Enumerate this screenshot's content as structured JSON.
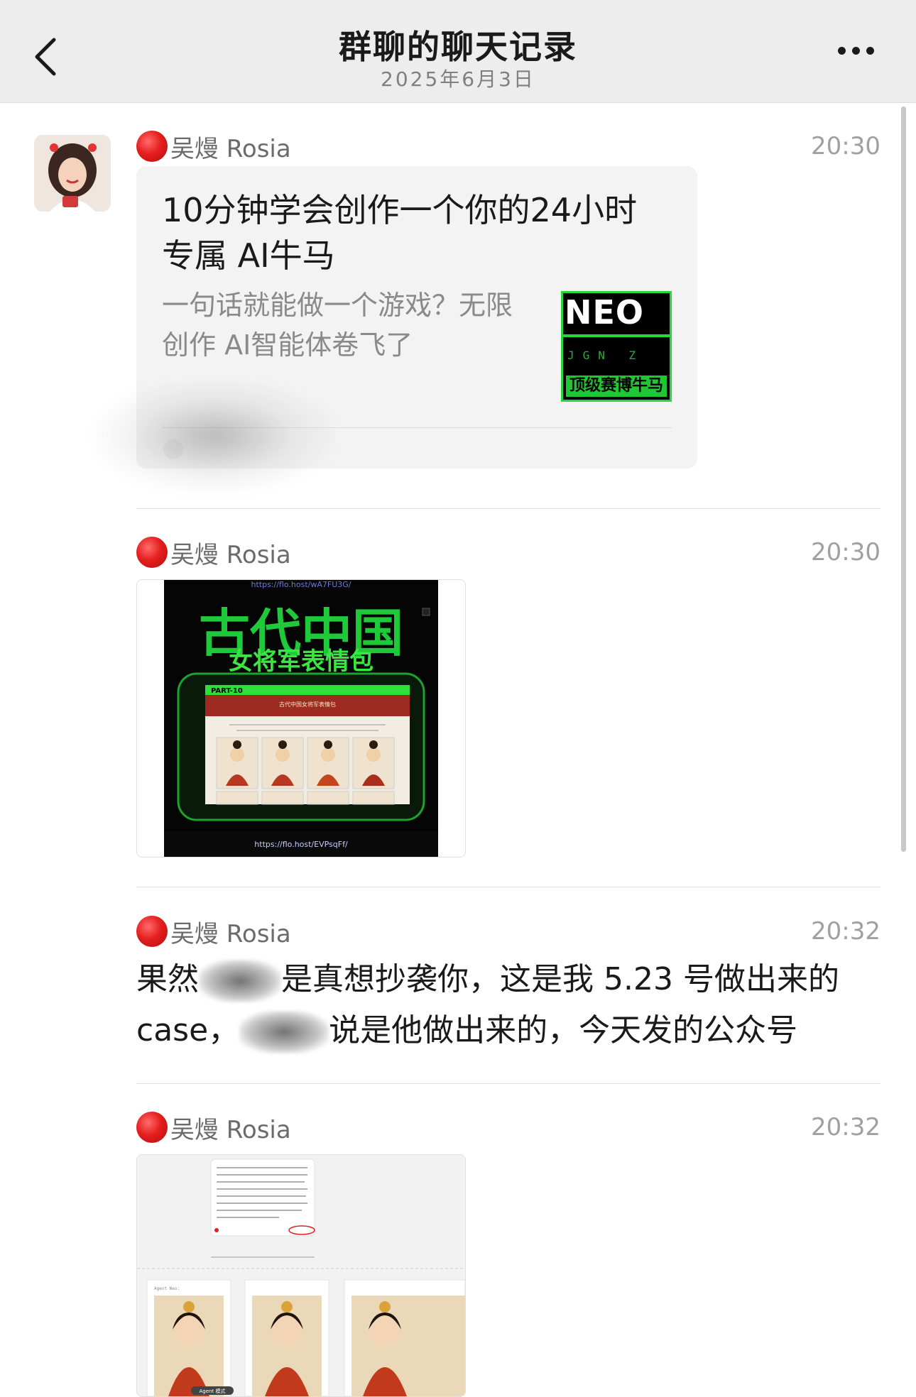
{
  "header": {
    "title": "群聊的聊天记录",
    "date": "2025年6月3日"
  },
  "messages": [
    {
      "sender": "吴熳 Rosia",
      "time": "20:30",
      "card": {
        "title": "10分钟学会创作一个你的24小时专属 AI牛马",
        "description": "一句话就能做一个游戏？无限创作 AI智能体卷飞了",
        "thumb_text": "NEO",
        "thumb_tag": "顶级赛博牛马"
      }
    },
    {
      "sender": "吴熳 Rosia",
      "time": "20:30",
      "image": {
        "url_top": "https://flo.host/wA7FU3G/",
        "title_big": "古代中国",
        "title_sub": "女将军表情包",
        "panel_label": "PART-10",
        "panel_heading": "古代中国女将军表情包",
        "url_bottom": "https://flo.host/EVPsqFf/"
      }
    },
    {
      "sender": "吴熳 Rosia",
      "time": "20:32",
      "text_parts": [
        "果然",
        "是真想抄袭你，这是我 5.23 号做出来的 case，",
        "说是他做出来的，今天发的公众号"
      ]
    },
    {
      "sender": "吴熳 Rosia",
      "time": "20:32",
      "image2": {
        "agent_label": "Agent Neo:",
        "mode_label": "Agent 模式"
      }
    }
  ],
  "colors": {
    "header_bg": "#ededed",
    "card_bg": "#f3f3f3",
    "neo_green": "#27d83c",
    "sender_dot": "#e51f1f"
  }
}
